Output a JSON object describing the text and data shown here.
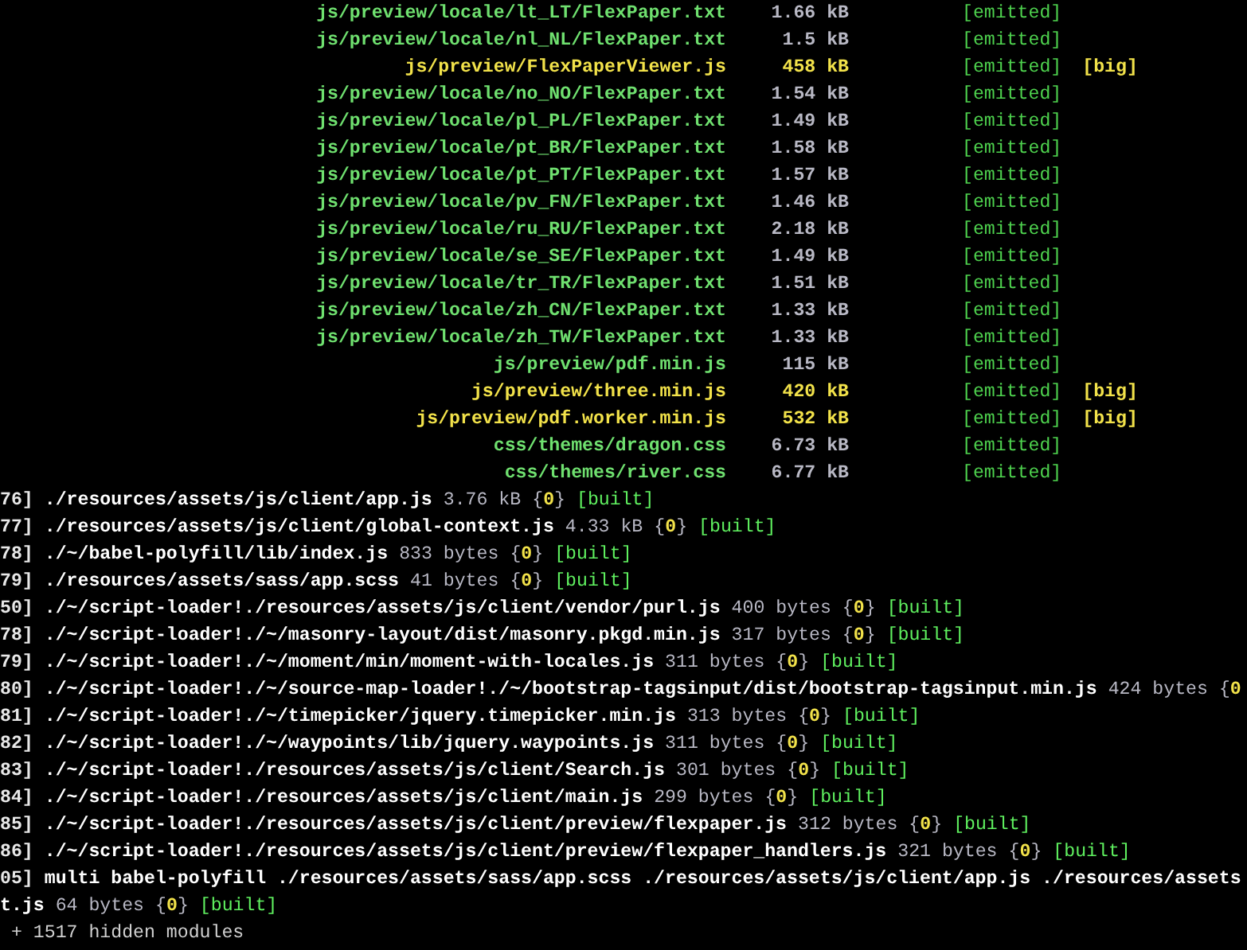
{
  "assets": [
    {
      "name": "js/preview/locale/lt_LT/FlexPaper.txt",
      "size": "1.66 kB",
      "status": "[emitted]",
      "big": false
    },
    {
      "name": "js/preview/locale/nl_NL/FlexPaper.txt",
      "size": "1.5 kB",
      "status": "[emitted]",
      "big": false
    },
    {
      "name": "js/preview/FlexPaperViewer.js",
      "size": "458 kB",
      "status": "[emitted]",
      "big": true,
      "flag": "[big]"
    },
    {
      "name": "js/preview/locale/no_NO/FlexPaper.txt",
      "size": "1.54 kB",
      "status": "[emitted]",
      "big": false
    },
    {
      "name": "js/preview/locale/pl_PL/FlexPaper.txt",
      "size": "1.49 kB",
      "status": "[emitted]",
      "big": false
    },
    {
      "name": "js/preview/locale/pt_BR/FlexPaper.txt",
      "size": "1.58 kB",
      "status": "[emitted]",
      "big": false
    },
    {
      "name": "js/preview/locale/pt_PT/FlexPaper.txt",
      "size": "1.57 kB",
      "status": "[emitted]",
      "big": false
    },
    {
      "name": "js/preview/locale/pv_FN/FlexPaper.txt",
      "size": "1.46 kB",
      "status": "[emitted]",
      "big": false
    },
    {
      "name": "js/preview/locale/ru_RU/FlexPaper.txt",
      "size": "2.18 kB",
      "status": "[emitted]",
      "big": false
    },
    {
      "name": "js/preview/locale/se_SE/FlexPaper.txt",
      "size": "1.49 kB",
      "status": "[emitted]",
      "big": false
    },
    {
      "name": "js/preview/locale/tr_TR/FlexPaper.txt",
      "size": "1.51 kB",
      "status": "[emitted]",
      "big": false
    },
    {
      "name": "js/preview/locale/zh_CN/FlexPaper.txt",
      "size": "1.33 kB",
      "status": "[emitted]",
      "big": false
    },
    {
      "name": "js/preview/locale/zh_TW/FlexPaper.txt",
      "size": "1.33 kB",
      "status": "[emitted]",
      "big": false
    },
    {
      "name": "js/preview/pdf.min.js",
      "size": "115 kB",
      "status": "[emitted]",
      "big": false
    },
    {
      "name": "js/preview/three.min.js",
      "size": "420 kB",
      "status": "[emitted]",
      "big": true,
      "flag": "[big]"
    },
    {
      "name": "js/preview/pdf.worker.min.js",
      "size": "532 kB",
      "status": "[emitted]",
      "big": true,
      "flag": "[big]"
    },
    {
      "name": "css/themes/dragon.css",
      "size": "6.73 kB",
      "status": "[emitted]",
      "big": false
    },
    {
      "name": "css/themes/river.css",
      "size": "6.77 kB",
      "status": "[emitted]",
      "big": false
    }
  ],
  "modules": [
    {
      "id": "76]",
      "path": "./resources/assets/js/client/app.js",
      "size": "3.76 kB",
      "chunk": "{0}",
      "status": "[built]"
    },
    {
      "id": "77]",
      "path": "./resources/assets/js/client/global-context.js",
      "size": "4.33 kB",
      "chunk": "{0}",
      "status": "[built]"
    },
    {
      "id": "78]",
      "path": "./~/babel-polyfill/lib/index.js",
      "size": "833 bytes",
      "chunk": "{0}",
      "status": "[built]"
    },
    {
      "id": "79]",
      "path": "./resources/assets/sass/app.scss",
      "size": "41 bytes",
      "chunk": "{0}",
      "status": "[built]"
    },
    {
      "id": "50]",
      "path": "./~/script-loader!./resources/assets/js/client/vendor/purl.js",
      "size": "400 bytes",
      "chunk": "{0}",
      "status": "[built]"
    },
    {
      "id": "78]",
      "path": "./~/script-loader!./~/masonry-layout/dist/masonry.pkgd.min.js",
      "size": "317 bytes",
      "chunk": "{0}",
      "status": "[built]"
    },
    {
      "id": "79]",
      "path": "./~/script-loader!./~/moment/min/moment-with-locales.js",
      "size": "311 bytes",
      "chunk": "{0}",
      "status": "[built]"
    },
    {
      "id": "80]",
      "path": "./~/script-loader!./~/source-map-loader!./~/bootstrap-tagsinput/dist/bootstrap-tagsinput.min.js",
      "size": "424 bytes",
      "chunk": "{0"
    },
    {
      "id": "81]",
      "path": "./~/script-loader!./~/timepicker/jquery.timepicker.min.js",
      "size": "313 bytes",
      "chunk": "{0}",
      "status": "[built]"
    },
    {
      "id": "82]",
      "path": "./~/script-loader!./~/waypoints/lib/jquery.waypoints.js",
      "size": "311 bytes",
      "chunk": "{0}",
      "status": "[built]"
    },
    {
      "id": "83]",
      "path": "./~/script-loader!./resources/assets/js/client/Search.js",
      "size": "301 bytes",
      "chunk": "{0}",
      "status": "[built]"
    },
    {
      "id": "84]",
      "path": "./~/script-loader!./resources/assets/js/client/main.js",
      "size": "299 bytes",
      "chunk": "{0}",
      "status": "[built]"
    },
    {
      "id": "85]",
      "path": "./~/script-loader!./resources/assets/js/client/preview/flexpaper.js",
      "size": "312 bytes",
      "chunk": "{0}",
      "status": "[built]"
    },
    {
      "id": "86]",
      "path": "./~/script-loader!./resources/assets/js/client/preview/flexpaper_handlers.js",
      "size": "321 bytes",
      "chunk": "{0}",
      "status": "[built]"
    },
    {
      "id": "05]",
      "path": "multi babel-polyfill ./resources/assets/sass/app.scss ./resources/assets/js/client/app.js ./resources/assets"
    },
    {
      "path": "t.js",
      "size": "64 bytes",
      "chunk": "{0}",
      "status": "[built]"
    }
  ],
  "hidden_note": "+ 1517 hidden modules"
}
